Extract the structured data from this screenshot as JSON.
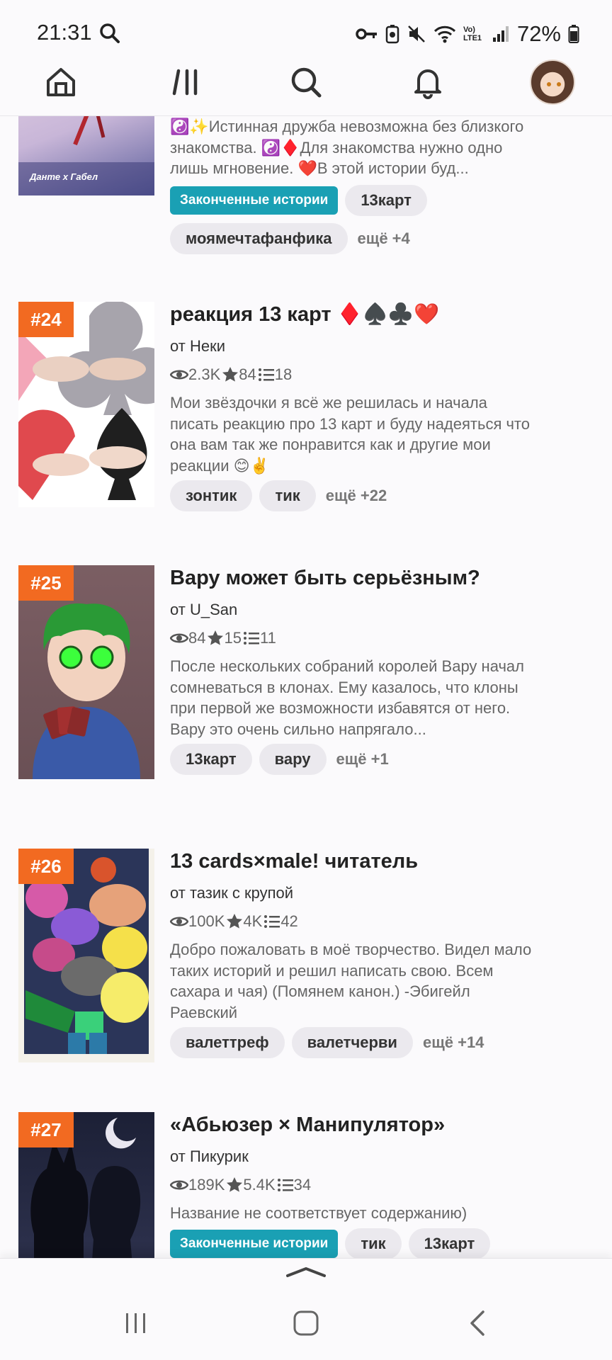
{
  "status_bar": {
    "time": "21:31",
    "battery": "72%",
    "network_label": "Vo) LTE1",
    "icons": [
      "search-icon",
      "key-icon",
      "battery-saver-icon",
      "mute-icon",
      "wifi-icon",
      "signal-icon",
      "battery-icon"
    ]
  },
  "top_nav": {
    "items": [
      "home-icon",
      "library-icon",
      "search-icon",
      "bell-icon",
      "avatar"
    ]
  },
  "stories": [
    {
      "rank": "",
      "title": "",
      "author": "",
      "description": "☯️✨Истинная дружба невозможна без близкого знакомства. ☯️♦️Для знакомства нужно одно лишь мгновение. ❤️В этой истории буд...",
      "cover_text": "Данте х Габел",
      "tags": [
        "Законченные истории",
        "13карт",
        "моямечтафанфика"
      ],
      "more": "ещё +4"
    },
    {
      "rank": "#24",
      "title": "реакция 13 карт ♦️♠️♣️❤️",
      "author": "от Неки",
      "views": "2.3K",
      "votes": "84",
      "parts": "18",
      "description": "Мои звёздочки я всё же решилась и начала писать реакцию про 13 карт и буду надеяться что она вам так же понравится как и другие мои реакции 😊✌️",
      "tags": [
        "зонтик",
        "тик"
      ],
      "more": "ещё +22"
    },
    {
      "rank": "#25",
      "title": "Вару может быть серьёзным?",
      "author": "от U_San",
      "views": "84",
      "votes": "15",
      "parts": "11",
      "description": "После нескольких собраний королей Вару начал сомневаться в клонах. Ему казалось, что клоны при первой же возможности избавятся от него. Вару это очень сильно напрягало...",
      "tags": [
        "13карт",
        "вару"
      ],
      "more": "ещё +1"
    },
    {
      "rank": "#26",
      "title": "13 cards×male! читатель",
      "author": "от тазик с крупой",
      "views": "100K",
      "votes": "4K",
      "parts": "42",
      "description": "Добро пожаловать в моё творчество. Видел мало таких историй и решил написать свою. Всем сахара и чая) (Помянем канон.) -Эбигейл Раевский",
      "tags": [
        "валеттреф",
        "валетчерви"
      ],
      "more": "ещё +14"
    },
    {
      "rank": "#27",
      "title": "«Абьюзер × Манипулятор»",
      "author": "от Пикурик",
      "views": "189K",
      "votes": "5.4K",
      "parts": "34",
      "description": "Название не соответствует содержанию)",
      "tags": [
        "Законченные истории",
        "тик",
        "13карт"
      ],
      "more": ""
    }
  ],
  "colors": {
    "rank_badge": "#f26a21",
    "completed_tag": "#1aa0b4",
    "tag_bg": "#ebe9ee",
    "background": "#fbfafc"
  },
  "system_nav": [
    "recents-icon",
    "home-button-icon",
    "back-icon"
  ]
}
